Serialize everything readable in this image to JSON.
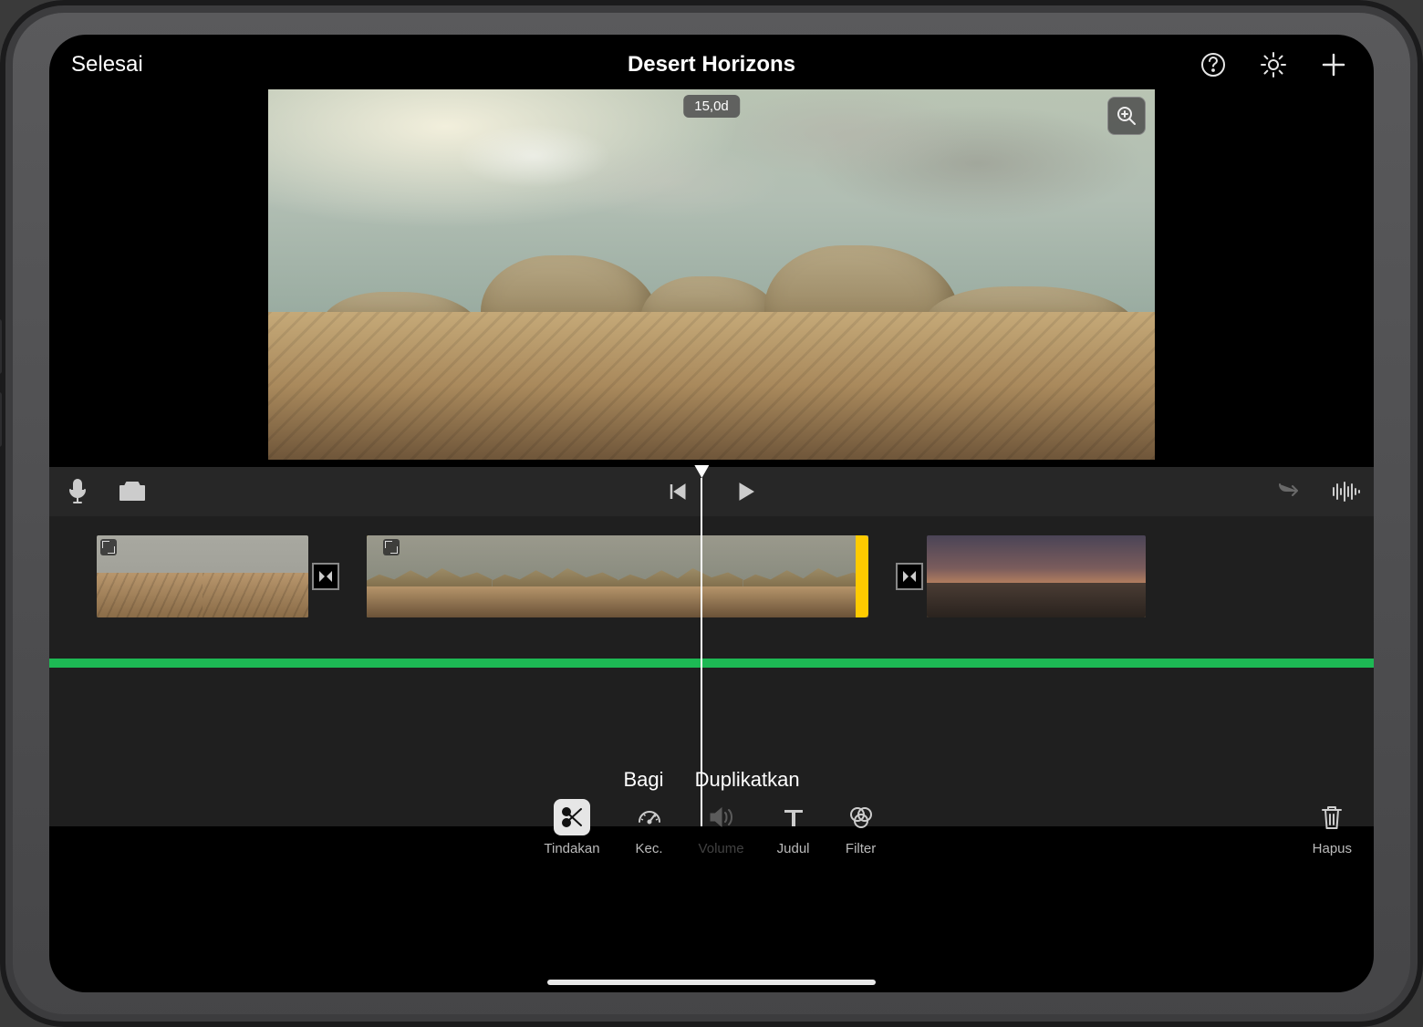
{
  "header": {
    "done_label": "Selesai",
    "title": "Desert Horizons"
  },
  "viewer": {
    "duration_badge": "15,0d"
  },
  "context_actions": {
    "split": "Bagi",
    "duplicate": "Duplikatkan"
  },
  "toolbar": {
    "items": [
      {
        "id": "tindakan",
        "label": "Tindakan",
        "active": true
      },
      {
        "id": "kec",
        "label": "Kec.",
        "active": false
      },
      {
        "id": "volume",
        "label": "Volume",
        "active": false,
        "disabled": true
      },
      {
        "id": "judul",
        "label": "Judul",
        "active": false
      },
      {
        "id": "filter",
        "label": "Filter",
        "active": false
      }
    ],
    "delete_label": "Hapus"
  },
  "icons": {
    "help": "help-icon",
    "settings": "gear-icon",
    "add": "plus-icon",
    "mic": "microphone-icon",
    "camera": "camera-icon",
    "skip_back": "skip-back-icon",
    "play": "play-icon",
    "undo": "undo-icon",
    "waveform": "waveform-icon",
    "zoom": "magnify-plus-icon"
  }
}
